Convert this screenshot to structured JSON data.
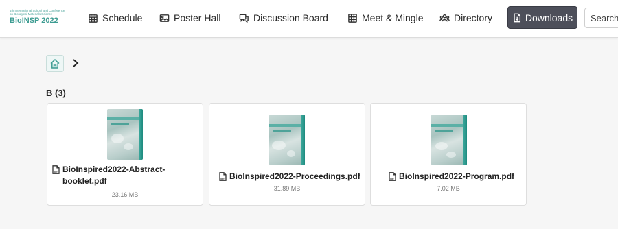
{
  "header": {
    "logo": {
      "line1": "4th International School and Conference",
      "line2": "on Biological Materials Science",
      "title": "BioINSP 2022"
    },
    "nav": [
      {
        "label": "Schedule",
        "icon": "calendar-icon"
      },
      {
        "label": "Poster Hall",
        "icon": "image-icon"
      },
      {
        "label": "Discussion Board",
        "icon": "chat-icon"
      },
      {
        "label": "Meet & Mingle",
        "icon": "grid-icon"
      },
      {
        "label": "Directory",
        "icon": "people-icon"
      }
    ],
    "active": {
      "label": "Downloads",
      "icon": "document-icon"
    },
    "search_placeholder": "Search"
  },
  "breadcrumb": {
    "home_icon": "home-icon",
    "separator_icon": "chevron-right-icon"
  },
  "section": {
    "title": "B (3)"
  },
  "files": [
    {
      "name": "BioInspired2022-Abstract-booklet.pdf",
      "size": "23.16 MB",
      "icon": "pdf-file-icon"
    },
    {
      "name": "BioInspired2022-Proceedings.pdf",
      "size": "31.89 MB",
      "icon": "pdf-file-icon"
    },
    {
      "name": "BioInspired2022-Program.pdf",
      "size": "7.02 MB",
      "icon": "pdf-file-icon"
    }
  ],
  "colors": {
    "accent": "#3d9c92",
    "active_nav_bg": "#4d4f5a",
    "page_bg": "#f6f6f6"
  }
}
